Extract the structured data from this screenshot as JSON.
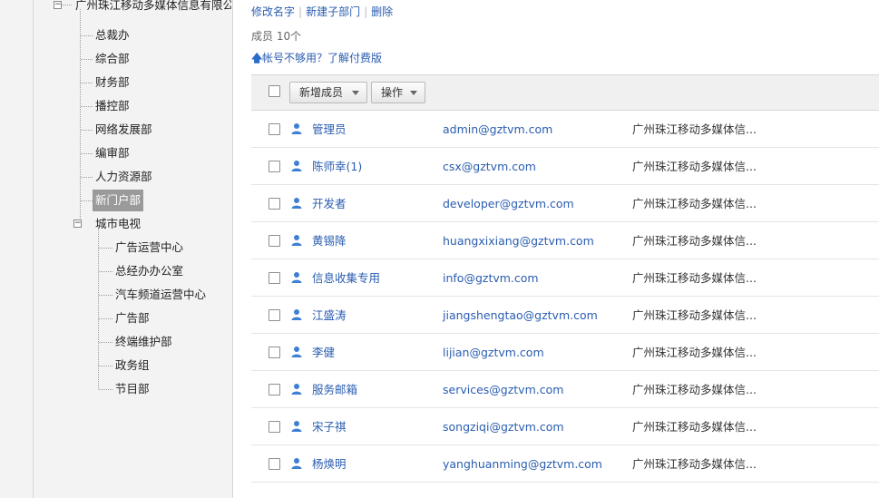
{
  "tree": {
    "root": {
      "label": "广州珠江移动多媒体信息有限公司",
      "expander": "−"
    },
    "departments": [
      {
        "label": "总裁办"
      },
      {
        "label": "综合部"
      },
      {
        "label": "财务部"
      },
      {
        "label": "播控部"
      },
      {
        "label": "网络发展部"
      },
      {
        "label": "编审部"
      },
      {
        "label": "人力资源部"
      },
      {
        "label": "新门户部",
        "selected": true
      }
    ],
    "city_tv": {
      "label": "城市电视",
      "expander": "−",
      "children": [
        {
          "label": "广告运营中心"
        },
        {
          "label": "总经办办公室"
        },
        {
          "label": "汽车频道运营中心"
        },
        {
          "label": "广告部"
        },
        {
          "label": "终端维护部"
        },
        {
          "label": "政务组"
        },
        {
          "label": "节目部"
        }
      ]
    }
  },
  "actions": {
    "rename": "修改名字",
    "new_subdept": "新建子部门",
    "delete": "删除"
  },
  "member_count": "成员 10个",
  "upgrade_link": "帐号不够用？了解付费版",
  "toolbar": {
    "add_member": "新增成员",
    "operate": "操作"
  },
  "members": [
    {
      "name": "管理员",
      "email": "admin@gztvm.com",
      "dept": "广州珠江移动多媒体信..."
    },
    {
      "name": "陈师幸(1)",
      "email": "csx@gztvm.com",
      "dept": "广州珠江移动多媒体信..."
    },
    {
      "name": "开发者",
      "email": "developer@gztvm.com",
      "dept": "广州珠江移动多媒体信..."
    },
    {
      "name": "黄锡降",
      "email": "huangxixiang@gztvm.com",
      "dept": "广州珠江移动多媒体信..."
    },
    {
      "name": "信息收集专用",
      "email": "info@gztvm.com",
      "dept": "广州珠江移动多媒体信..."
    },
    {
      "name": "江盛涛",
      "email": "jiangshengtao@gztvm.com",
      "dept": "广州珠江移动多媒体信..."
    },
    {
      "name": "李健",
      "email": "lijian@gztvm.com",
      "dept": "广州珠江移动多媒体信..."
    },
    {
      "name": "服务邮箱",
      "email": "services@gztvm.com",
      "dept": "广州珠江移动多媒体信..."
    },
    {
      "name": "宋子祺",
      "email": "songziqi@gztvm.com",
      "dept": "广州珠江移动多媒体信..."
    },
    {
      "name": "杨焕明",
      "email": "yanghuanming@gztvm.com",
      "dept": "广州珠江移动多媒体信..."
    }
  ],
  "colors": {
    "link": "#2a5db0",
    "selected_bg": "#9a9a9a",
    "icon": "#3d7fd4"
  }
}
